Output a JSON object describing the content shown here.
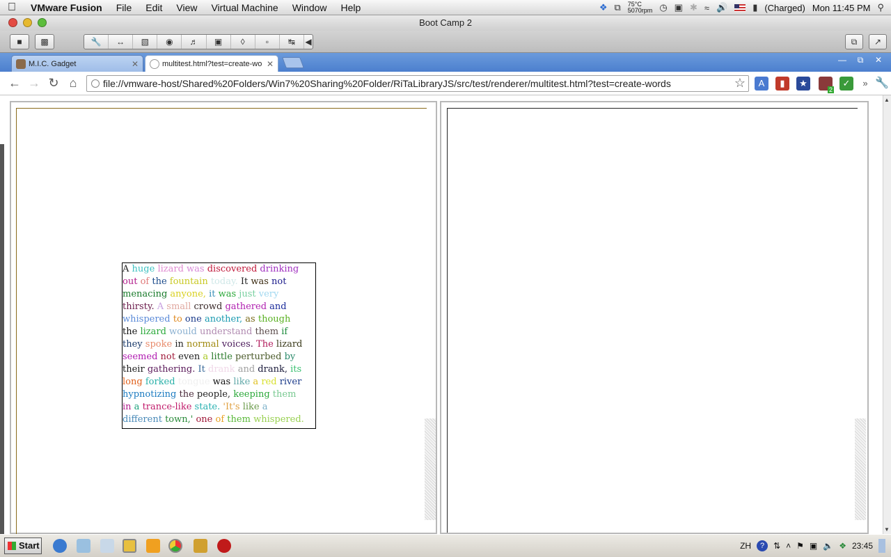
{
  "menubar": {
    "app": "VMware Fusion",
    "items": [
      "File",
      "Edit",
      "View",
      "Virtual Machine",
      "Window",
      "Help"
    ],
    "temp": "75°C",
    "fan": "5070rpm",
    "battery": "(Charged)",
    "clock": "Mon 11:45 PM"
  },
  "fusion": {
    "title": "Boot Camp 2"
  },
  "browser": {
    "tabs": [
      {
        "label": "M.I.C. Gadget",
        "active": false
      },
      {
        "label": "multitest.html?test=create-wo",
        "active": true
      }
    ],
    "url": "file://vmware-host/Shared%20Folders/Win7%20Sharing%20Folder/RiTaLibraryJS/src/test/renderer/multitest.html?test=create-words",
    "extension_badge": "2"
  },
  "textbox": {
    "lines": [
      [
        [
          "A",
          "#222"
        ],
        [
          "huge",
          "#3cc0c0"
        ],
        [
          "lizard",
          "#e08ad0"
        ],
        [
          "was",
          "#d88ad8"
        ],
        [
          "discovered",
          "#c0183a"
        ],
        [
          "drinking",
          "#a030c0"
        ]
      ],
      [
        [
          "out",
          "#b01a8a"
        ],
        [
          "of",
          "#e07a7a"
        ],
        [
          "the",
          "#1a4a8a"
        ],
        [
          "fountain",
          "#c8c820"
        ],
        [
          "today.",
          "#d0e8e8"
        ],
        [
          "It",
          "#222"
        ],
        [
          "was",
          "#3a2a10"
        ],
        [
          "not",
          "#1a1a8a"
        ]
      ],
      [
        [
          "menacing",
          "#187a2a"
        ],
        [
          "anyone,",
          "#d8d020"
        ],
        [
          "it",
          "#3a90b8"
        ],
        [
          "was",
          "#2aa838"
        ],
        [
          "just",
          "#7ad0a0"
        ],
        [
          "very",
          "#a0d8f0"
        ]
      ],
      [
        [
          "thirsty.",
          "#6a1a4a"
        ],
        [
          "A",
          "#c8a0e0"
        ],
        [
          "small",
          "#e0a8a0"
        ],
        [
          "crowd",
          "#3a2a2a"
        ],
        [
          "gathered",
          "#b020b0"
        ],
        [
          "and",
          "#1a2a9a"
        ]
      ],
      [
        [
          "whispered",
          "#5a8ad8"
        ],
        [
          "to",
          "#e08a20"
        ],
        [
          "one",
          "#1a3a8a"
        ],
        [
          "another,",
          "#1a9ab0"
        ],
        [
          "as",
          "#7a6a1a"
        ],
        [
          "though",
          "#58b020"
        ]
      ],
      [
        [
          "the",
          "#111"
        ],
        [
          "lizard",
          "#28a838"
        ],
        [
          "would",
          "#8ab0d0"
        ],
        [
          "understand",
          "#b08ab0"
        ],
        [
          "them",
          "#5a4a4a"
        ],
        [
          "if",
          "#1a8a3a"
        ]
      ],
      [
        [
          "they",
          "#1a3a6a"
        ],
        [
          "spoke",
          "#e88a6a"
        ],
        [
          "in",
          "#222"
        ],
        [
          "normal",
          "#a08a10"
        ],
        [
          "voices.",
          "#4a1a5a"
        ],
        [
          "The",
          "#b01a5a"
        ],
        [
          "lizard",
          "#3a3a1a"
        ]
      ],
      [
        [
          "seemed",
          "#b01ab0"
        ],
        [
          "not",
          "#a01a3a"
        ],
        [
          "even",
          "#1a1a1a"
        ],
        [
          "a",
          "#a8c820"
        ],
        [
          "little",
          "#2a7a2a"
        ],
        [
          "perturbed",
          "#4a5a2a"
        ],
        [
          "by",
          "#2a8a6a"
        ]
      ],
      [
        [
          "their",
          "#1a1a1a"
        ],
        [
          "gathering.",
          "#5a1a5a"
        ],
        [
          "It",
          "#3a6a9a"
        ],
        [
          "drank",
          "#f0d8e8"
        ],
        [
          "and",
          "#a0a0a0"
        ],
        [
          "drank,",
          "#1a1a3a"
        ],
        [
          "its",
          "#3ac070"
        ]
      ],
      [
        [
          "long",
          "#e0601a"
        ],
        [
          "forked",
          "#28b0a8"
        ],
        [
          "tongue",
          "#f0f0f0"
        ],
        [
          "was",
          "#111"
        ],
        [
          "like",
          "#60a8a8"
        ],
        [
          "a",
          "#e0c020"
        ],
        [
          "red",
          "#d8e030"
        ],
        [
          "river",
          "#1a3a8a"
        ]
      ],
      [
        [
          "hypnotizing",
          "#1a7ac0"
        ],
        [
          "the",
          "#4a2a3a"
        ],
        [
          "people,",
          "#222"
        ],
        [
          "keeping",
          "#2aa838"
        ],
        [
          "them",
          "#78c890"
        ]
      ],
      [
        [
          "in",
          "#b01a8a"
        ],
        [
          "a",
          "#1aa07a"
        ],
        [
          "trance-like",
          "#c01a6a"
        ],
        [
          "state.",
          "#28b0b0"
        ],
        [
          "'It's",
          "#e0a040"
        ],
        [
          "like",
          "#6a9a4a"
        ],
        [
          "a",
          "#7ab0c8"
        ]
      ],
      [
        [
          "different",
          "#4a8ab8"
        ],
        [
          "town,'",
          "#2a8a3a"
        ],
        [
          "one",
          "#a01a3a"
        ],
        [
          "of",
          "#e8a020"
        ],
        [
          "them",
          "#58b838"
        ],
        [
          "whispered.",
          "#98d050"
        ]
      ]
    ]
  },
  "taskbar": {
    "start": "Start",
    "lang": "ZH",
    "time": "23:45"
  }
}
